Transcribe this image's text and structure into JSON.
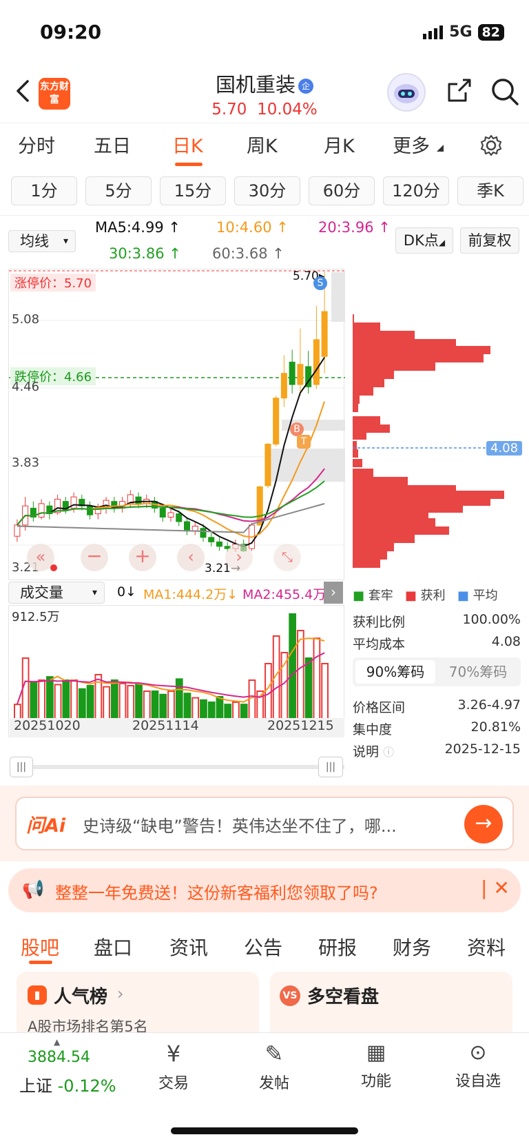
{
  "status": {
    "time": "09:20",
    "network": "5G",
    "battery": "82"
  },
  "header": {
    "logo_text": "东方财富",
    "stock_name": "国机重装",
    "badge": "企",
    "price": "5.70",
    "change_pct": "10.04%"
  },
  "period_tabs": [
    "分时",
    "五日",
    "日K",
    "周K",
    "月K",
    "更多"
  ],
  "minute_buttons": [
    "1分",
    "5分",
    "15分",
    "30分",
    "60分",
    "120分",
    "季K"
  ],
  "ma": {
    "selector": "均线",
    "ma5": "MA5:4.99",
    "ma10": "10:4.60",
    "ma20": "20:3.96",
    "ma30": "30:3.86",
    "ma60": "60:3.68",
    "dk_label": "DK点",
    "adjust_label": "前复权"
  },
  "kline": {
    "limit_up_label": "涨停价：5.70",
    "limit_down_label": "跌停价：4.66",
    "high_marker": "5.70",
    "low_marker": "3.21",
    "ticks": [
      "5.70",
      "5.08",
      "4.46",
      "3.83",
      "3.21"
    ],
    "buy_mark": "B",
    "sell_mark": "S",
    "t_mark": "T"
  },
  "volume": {
    "selector": "成交量",
    "v0": "0",
    "ma1": "MA1:444.2万",
    "ma2": "MA2:455.4万",
    "max_label": "912.5万",
    "dates": [
      "20251020",
      "20251114",
      "20251215"
    ]
  },
  "chips": {
    "legend": [
      "套牢",
      "获利",
      "平均"
    ],
    "avg_price": "4.08",
    "rows": [
      {
        "label": "获利比例",
        "value": "100.00%"
      },
      {
        "label": "平均成本",
        "value": "4.08"
      }
    ],
    "tabs": [
      "90%筹码",
      "70%筹码"
    ],
    "rows2": [
      {
        "label": "价格区间",
        "value": "3.26-4.97"
      },
      {
        "label": "集中度",
        "value": "20.81%"
      },
      {
        "label": "说明",
        "value": "2025-12-15"
      }
    ]
  },
  "ai": {
    "logo": "问Ai",
    "text": "史诗级“缺电”警告！英伟达坐不住了，哪..."
  },
  "promo": {
    "text": "整整一年免费送！这份新客福利您领取了吗?"
  },
  "section_tabs": [
    "股吧",
    "盘口",
    "资讯",
    "公告",
    "研报",
    "财务",
    "资料"
  ],
  "cards": {
    "left_title": "人气榜",
    "left_sub": "A股市场排名第5名",
    "right_title": "多空看盘"
  },
  "index": {
    "value": "3884.54",
    "name": "上证",
    "change": "-0.12%"
  },
  "nav": [
    "交易",
    "发帖",
    "功能",
    "设自选"
  ],
  "colors": {
    "accent": "#ff5a1f",
    "up": "#e83a3a",
    "down": "#1a9a1a",
    "ma5": "#111111",
    "ma10": "#f59a1b",
    "ma20": "#d4268f",
    "ma30": "#21a021",
    "ma60": "#888888"
  }
}
